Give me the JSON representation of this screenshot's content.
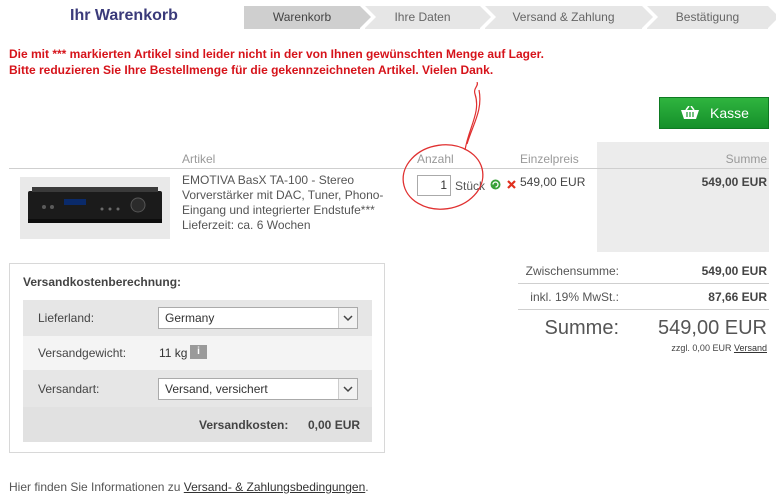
{
  "page": {
    "title": "Ihr Warenkorb"
  },
  "steps": [
    "Warenkorb",
    "Ihre Daten",
    "Versand & Zahlung",
    "Bestätigung"
  ],
  "warning": {
    "line1": "Die mit *** markierten Artikel sind leider nicht in der von Ihnen gewünschten Menge auf Lager.",
    "line2": "Bitte reduzieren Sie Ihre Bestellmenge für die gekennzeichneten Artikel. Vielen Dank."
  },
  "checkout_button": {
    "label": "Kasse",
    "icon": "basket-icon"
  },
  "table": {
    "headers": {
      "artikel": "Artikel",
      "anzahl": "Anzahl",
      "einzelpreis": "Einzelpreis",
      "summe": "Summe"
    },
    "item": {
      "name_l1": "EMOTIVA BasX TA-100 - Stereo",
      "name_l2": "Vorverstärker mit DAC, Tuner, Phono-",
      "name_l3": "Eingang und integrierter Endstufe***",
      "delivery": "Lieferzeit: ca. 6 Wochen",
      "quantity": "1",
      "unit": "Stück",
      "unit_price": "549,00 EUR",
      "sum": "549,00 EUR"
    }
  },
  "shipping": {
    "title": "Versandkostenberechnung:",
    "country_label": "Lieferland:",
    "country_value": "Germany",
    "weight_label": "Versandgewicht:",
    "weight_value": "11 kg",
    "info_icon": "i",
    "method_label": "Versandart:",
    "method_value": "Versand, versichert",
    "cost_label": "Versandkosten:",
    "cost_value": "0,00 EUR"
  },
  "totals": {
    "subtotal_label": "Zwischensumme:",
    "subtotal_value": "549,00 EUR",
    "tax_label": "inkl. 19% MwSt.:",
    "tax_value": "87,66 EUR",
    "sum_label": "Summe:",
    "sum_value": "549,00 EUR",
    "shipping_note": "zzgl. 0,00 EUR",
    "shipping_link": "Versand"
  },
  "footer": {
    "text": "Hier finden Sie Informationen zu",
    "link": "Versand- & Zahlungsbedingungen",
    "end": "."
  },
  "colors": {
    "warning": "#d6131a",
    "checkout": "#1ea533",
    "title": "#3a3a7a"
  }
}
